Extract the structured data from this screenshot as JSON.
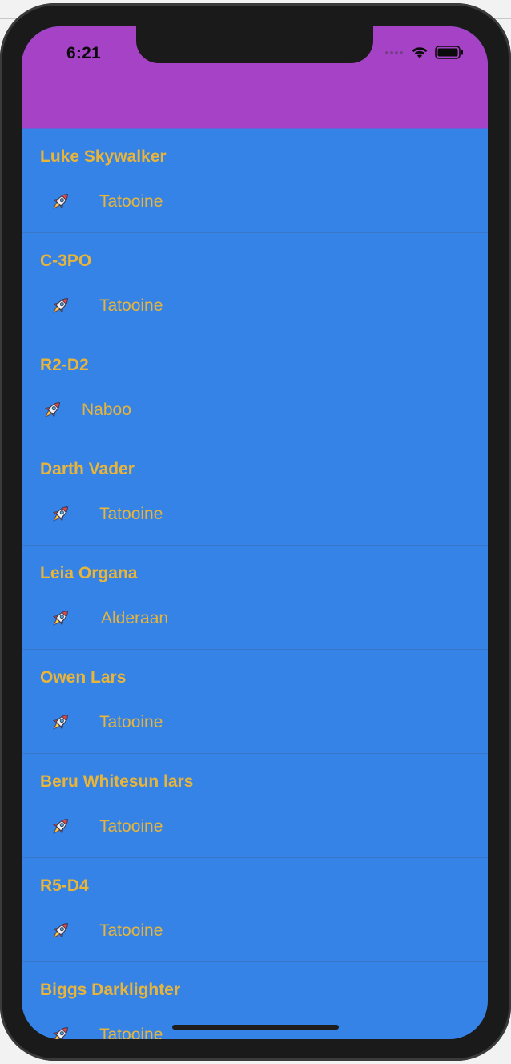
{
  "status_bar": {
    "time": "6:21",
    "signal_icon": "signal-dots-icon",
    "wifi_icon": "wifi-icon",
    "battery_icon": "battery-icon"
  },
  "header": {
    "color": "#a542c5"
  },
  "list": {
    "background": "#3583e6",
    "text_color": "#e8b53a",
    "item_icon": "rocket-icon",
    "items": [
      {
        "name": "Luke Skywalker",
        "planet": "Tatooine"
      },
      {
        "name": "C-3PO",
        "planet": "Tatooine"
      },
      {
        "name": "R2-D2",
        "planet": "Naboo"
      },
      {
        "name": "Darth Vader",
        "planet": "Tatooine"
      },
      {
        "name": "Leia Organa",
        "planet": "Alderaan"
      },
      {
        "name": "Owen Lars",
        "planet": "Tatooine"
      },
      {
        "name": "Beru Whitesun lars",
        "planet": "Tatooine"
      },
      {
        "name": "R5-D4",
        "planet": "Tatooine"
      },
      {
        "name": "Biggs Darklighter",
        "planet": "Tatooine"
      }
    ]
  }
}
